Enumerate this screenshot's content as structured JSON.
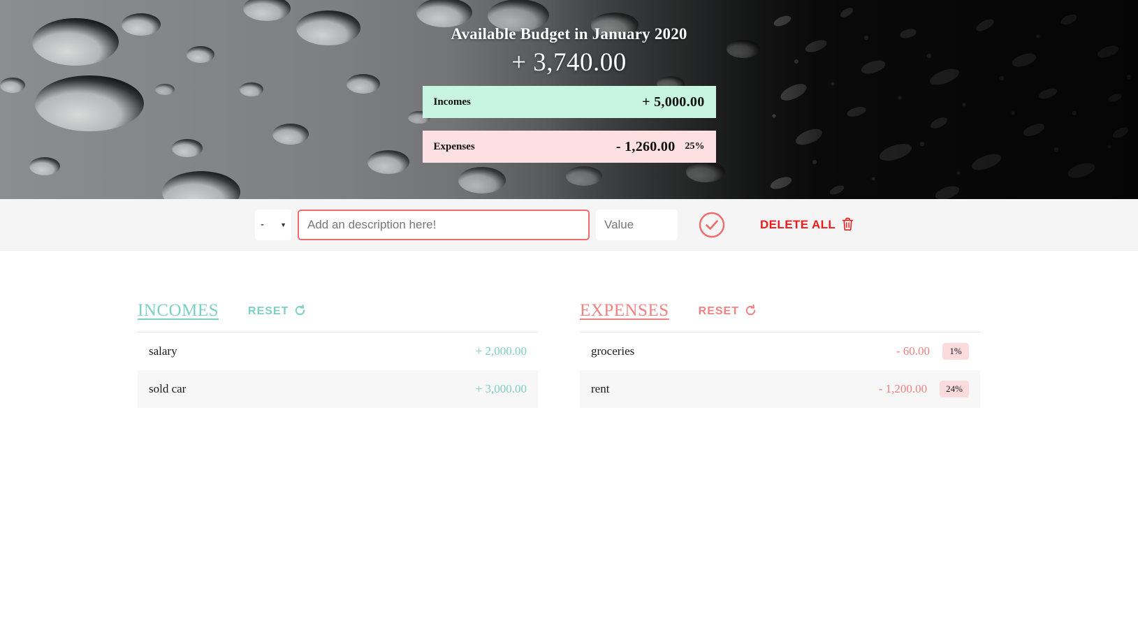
{
  "header": {
    "title": "Available Budget in January 2020",
    "budget_value": "+ 3,740.00",
    "income_label": "Incomes",
    "income_value": "+ 5,000.00",
    "expense_label": "Expenses",
    "expense_value": "- 1,260.00",
    "expense_percentage": "25%",
    "background_icon": "water-droplets-photo",
    "colors": {
      "income_box_bg": "#c8f4e2",
      "expense_box_bg": "#fde0e1"
    }
  },
  "toolbar": {
    "type_select_value": "-",
    "type_select_options": [
      "+",
      "-"
    ],
    "description_placeholder": "Add an description here!",
    "description_value": "",
    "value_placeholder": "Value",
    "value_value": "",
    "submit_icon": "check-circle-icon",
    "delete_all_label": "DELETE ALL",
    "delete_all_icon": "trash-icon",
    "colors": {
      "accent": "#ef6a6a",
      "danger": "#ef1b1b",
      "background": "#f5f5f5"
    }
  },
  "incomes": {
    "title": "INCOMES",
    "reset_label": "RESET",
    "reset_icon": "refresh-icon",
    "accent_color": "#7ed0c4",
    "rows": [
      {
        "description": "salary",
        "value": "+ 2,000.00"
      },
      {
        "description": "sold car",
        "value": "+ 3,000.00"
      }
    ]
  },
  "expenses": {
    "title": "EXPENSES",
    "reset_label": "RESET",
    "reset_icon": "refresh-icon",
    "accent_color": "#f08282",
    "rows": [
      {
        "description": "groceries",
        "value": "- 60.00",
        "percentage": "1%"
      },
      {
        "description": "rent",
        "value": "- 1,200.00",
        "percentage": "24%"
      }
    ]
  }
}
